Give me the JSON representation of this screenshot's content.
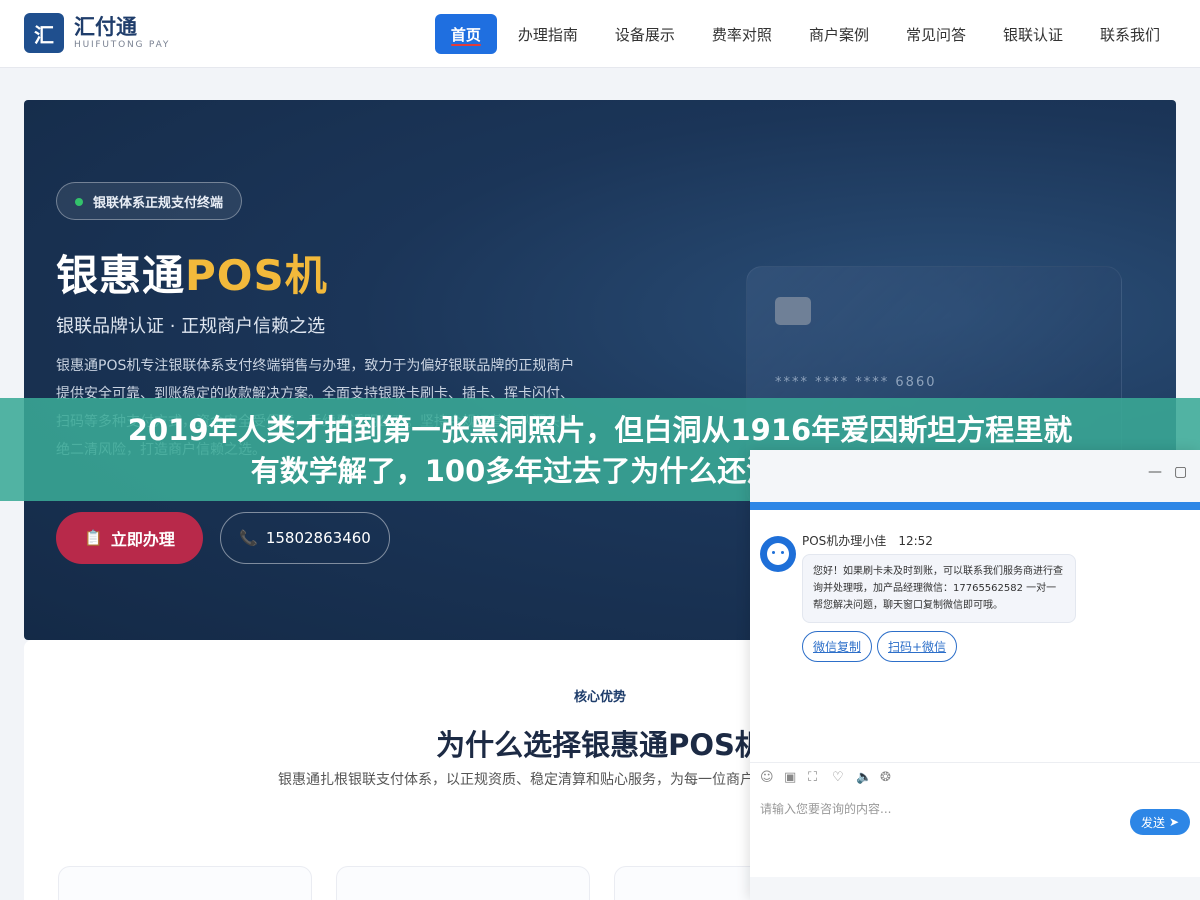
{
  "header": {
    "logo_badge": "汇",
    "logo_cn": "汇付通",
    "logo_en": "HUIFUTONG PAY",
    "nav": [
      "首页",
      "办理指南",
      "设备展示",
      "费率对照",
      "商户案例",
      "常见问答",
      "银联认证",
      "联系我们"
    ]
  },
  "hero": {
    "tag": "银联体系正规支付终端",
    "title_main": "银惠通",
    "title_gold": "POS机",
    "subtitle": "银联品牌认证 · 正规商户信赖之选",
    "desc": "银惠通POS机专注银联体系支付终端销售与办理，致力于为偏好银联品牌的正规商户提供安全可靠、到账稳定的收款解决方案。全面支持银联卡刷卡、插卡、挥卡闪付、扫码等多种支付方式，资金安全受保障，手续费透明公开。坚持合规运营，从源头杜绝二清风险，打造商户信赖之选。",
    "apply_button": "立即办理",
    "phone_button": "15802863460",
    "card_number": "**** **** **** 6860"
  },
  "headline": {
    "line1": "2019年人类才拍到第一张黑洞照片，但白洞从1916年爱因斯坦方程里就",
    "line2": "有数学解了，100多年过去了为什么还没找到哪怕一个"
  },
  "advantages": {
    "label": "核心优势",
    "title": "为什么选择银惠通POS机",
    "desc": "银惠通扎根银联支付体系，以正规资质、稳定清算和贴心服务，为每一位商户提供值得信赖的收款终端。"
  },
  "chat": {
    "agent_name": "POS机办理小佳",
    "time": "12:52",
    "message": "您好！如果刷卡未及时到账，可以联系我们服务商进行查询并处理哦，加产品经理微信：17765562582 一对一帮您解决问题，聊天窗口复制微信即可哦。",
    "quick_reply_1": "微信复制",
    "quick_reply_2": "扫码+微信",
    "input_placeholder": "请输入您要咨询的内容...",
    "send_button": "发送"
  }
}
